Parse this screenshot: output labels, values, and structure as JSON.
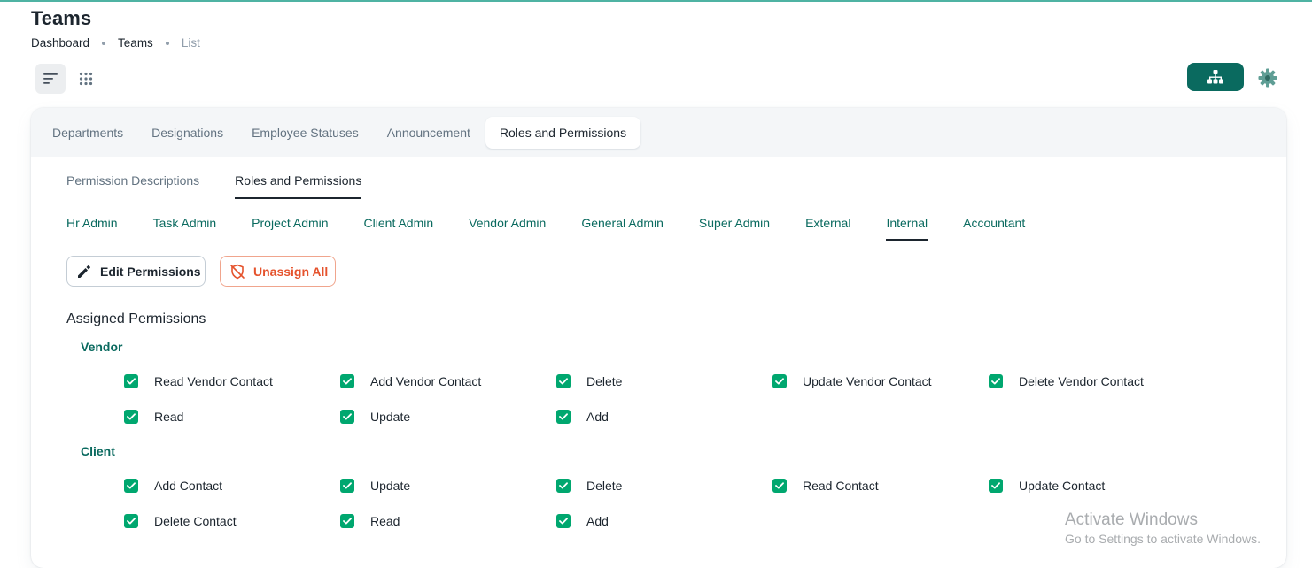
{
  "page": {
    "title": "Teams"
  },
  "breadcrumb": [
    "Dashboard",
    "Teams",
    "List"
  ],
  "main_tabs": [
    "Departments",
    "Designations",
    "Employee Statuses",
    "Announcement",
    "Roles and Permissions"
  ],
  "active_main_tab": "Roles and Permissions",
  "sub_tabs": [
    "Permission Descriptions",
    "Roles and Permissions"
  ],
  "role_tabs": [
    "Hr Admin",
    "Task Admin",
    "Project Admin",
    "Client Admin",
    "Vendor Admin",
    "General Admin",
    "Super Admin",
    "External",
    "Internal",
    "Accountant"
  ],
  "active_role_tab": "Internal",
  "buttons": {
    "edit": "Edit Permissions",
    "unassign": "Unassign All"
  },
  "assigned": {
    "title": "Assigned Permissions",
    "groups": [
      {
        "name": "Vendor",
        "items": [
          "Read Vendor Contact",
          "Add Vendor Contact",
          "Delete",
          "Update Vendor Contact",
          "Delete Vendor Contact",
          "Read",
          "Update",
          "Add"
        ]
      },
      {
        "name": "Client",
        "items": [
          "Add Contact",
          "Update",
          "Delete",
          "Read Contact",
          "Update Contact",
          "Delete Contact",
          "Read",
          "Add"
        ]
      }
    ]
  },
  "watermark": {
    "line1": "Activate Windows",
    "line2": "Go to Settings to activate Windows."
  },
  "colors": {
    "primary": "#0a6a5f",
    "checkbox": "#00a76f",
    "danger": "#e5532d"
  },
  "icons": [
    "list-view-icon",
    "grid-view-icon",
    "org-chart-icon",
    "gear-icon",
    "pencil-icon",
    "shield-off-icon",
    "check-icon"
  ]
}
